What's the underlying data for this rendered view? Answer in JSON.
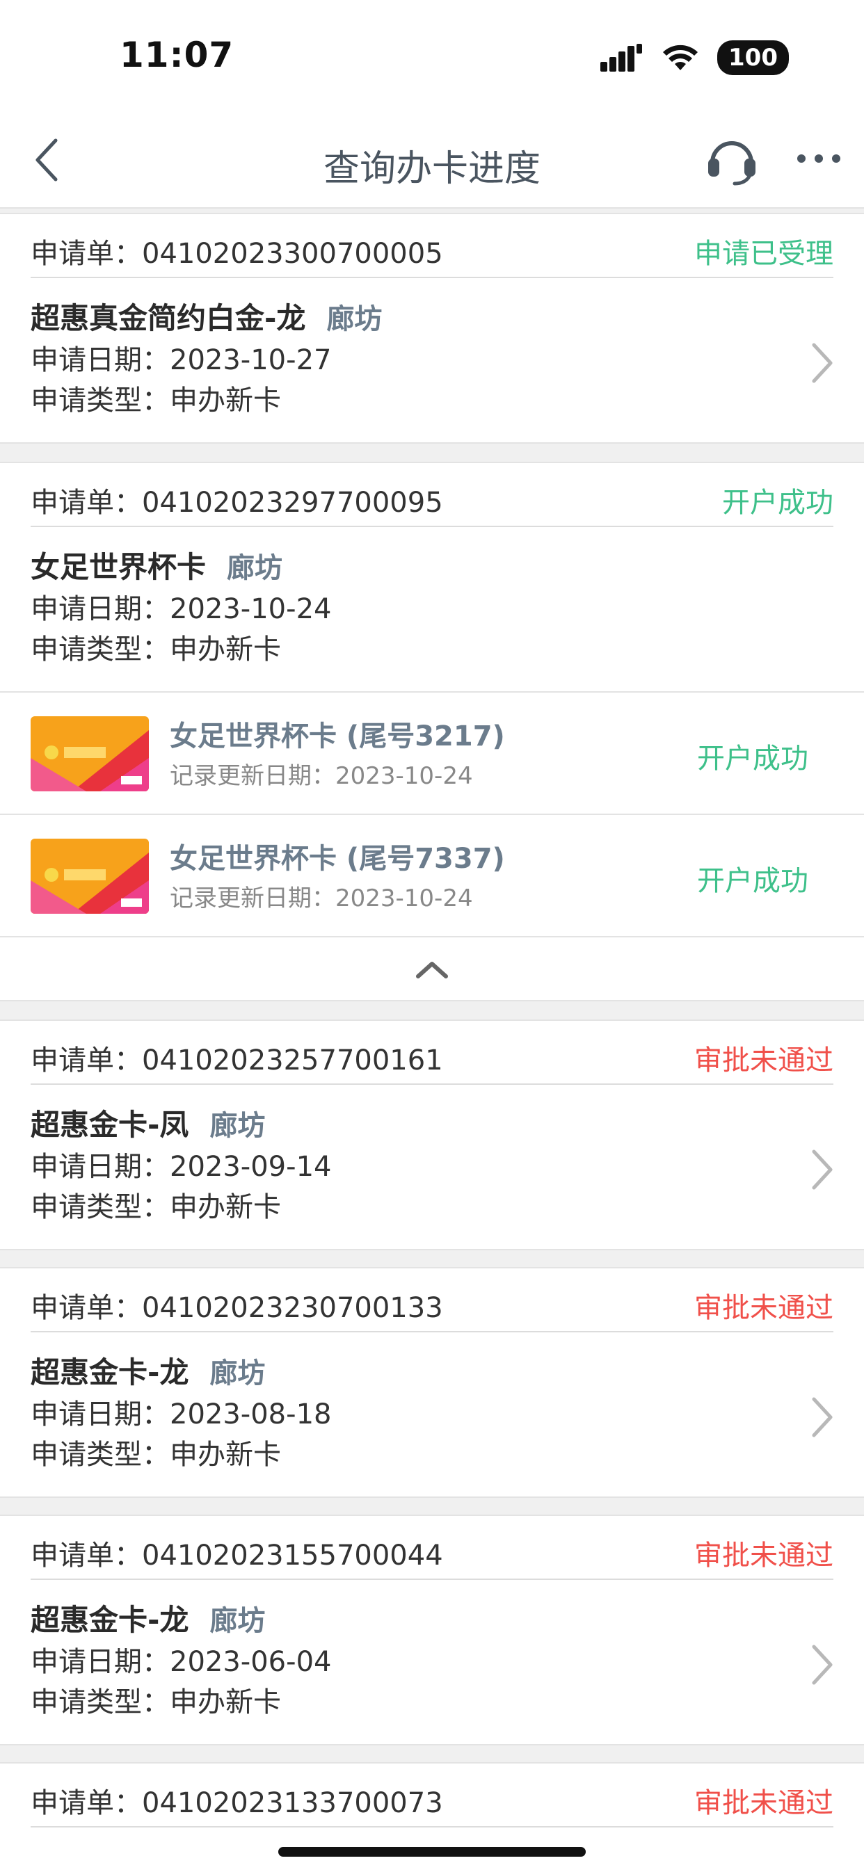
{
  "status_bar": {
    "time": "11:07",
    "battery": "100"
  },
  "nav": {
    "title": "查询办卡进度"
  },
  "labels": {
    "order_prefix": "申请单：",
    "date_prefix": "申请日期：",
    "type_prefix": "申请类型：",
    "record_prefix": "记录更新日期："
  },
  "applications": [
    {
      "order": "04102023300700005",
      "status": "申请已受理",
      "status_color": "#3ec08a",
      "card_name": "超惠真金简约白金-龙",
      "city": "廊坊",
      "date": "2023-10-27",
      "type": "申办新卡"
    },
    {
      "order": "04102023297700095",
      "status": "开户成功",
      "status_color": "#3ec08a",
      "card_name": "女足世界杯卡",
      "city": "廊坊",
      "date": "2023-10-24",
      "type": "申办新卡",
      "sub_cards": [
        {
          "name": "女足世界杯卡 (尾号3217)",
          "record_date": "2023-10-24",
          "status": "开户成功"
        },
        {
          "name": "女足世界杯卡 (尾号7337)",
          "record_date": "2023-10-24",
          "status": "开户成功"
        }
      ]
    },
    {
      "order": "04102023257700161",
      "status": "审批未通过",
      "status_color": "#f0504a",
      "card_name": "超惠金卡-凤",
      "city": "廊坊",
      "date": "2023-09-14",
      "type": "申办新卡"
    },
    {
      "order": "04102023230700133",
      "status": "审批未通过",
      "status_color": "#f0504a",
      "card_name": "超惠金卡-龙",
      "city": "廊坊",
      "date": "2023-08-18",
      "type": "申办新卡"
    },
    {
      "order": "04102023155700044",
      "status": "审批未通过",
      "status_color": "#f0504a",
      "card_name": "超惠金卡-龙",
      "city": "廊坊",
      "date": "2023-06-04",
      "type": "申办新卡"
    },
    {
      "order": "04102023133700073",
      "status": "审批未通过",
      "status_color": "#f0504a"
    }
  ],
  "icons": {
    "back": "chevron-left-icon",
    "service": "headset-icon",
    "more": "more-dots-icon",
    "chevron": "chevron-right-icon",
    "collapse": "chevron-up-icon"
  }
}
